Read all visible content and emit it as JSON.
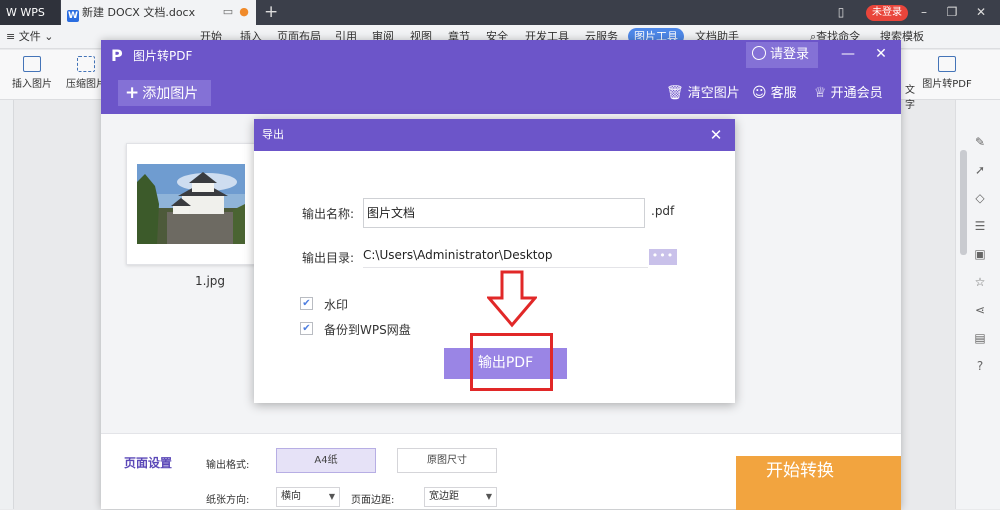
{
  "titlebar": {
    "app_tab": "WPS",
    "doc_tab": "新建 DOCX 文档.docx",
    "login_badge": "未登录"
  },
  "menubar": {
    "file": "文件",
    "items": [
      "开始",
      "插入",
      "页面布局",
      "引用",
      "审阅",
      "视图",
      "章节",
      "安全",
      "开发工具",
      "云服务",
      "图片工具",
      "文档助手"
    ],
    "right": [
      "查找命令",
      "搜索模板"
    ]
  },
  "ribbon": {
    "left_buttons": [
      "插入图片",
      "压缩图片"
    ],
    "right_buttons": [
      "文字",
      "图片转PDF"
    ]
  },
  "pdf_app": {
    "title": "图片转PDF",
    "login": "请登录",
    "add_image": "添加图片",
    "clear_images": "清空图片",
    "customer_service": "客服",
    "vip": "开通会员",
    "image_name": "1.jpg"
  },
  "settings": {
    "title": "页面设置",
    "output_format_label": "输出格式:",
    "format_a4": "A4纸",
    "format_original": "原图尺寸",
    "orientation_label": "纸张方向:",
    "orientation_value": "横向",
    "margin_label": "页面边距:",
    "margin_value": "宽边距",
    "start": "开始转换"
  },
  "export_dialog": {
    "title": "导出",
    "name_label": "输出名称:",
    "name_value": "图片文档",
    "ext": ".pdf",
    "dir_label": "输出目录:",
    "dir_value": "C:\\Users\\Administrator\\Desktop",
    "browse": "•••",
    "watermark": "水印",
    "watermark_checked": true,
    "backup": "备份到WPS网盘",
    "backup_checked": true,
    "output_button": "输出PDF"
  },
  "colors": {
    "purple": "#6c55c9",
    "output_button": "#9a85e5",
    "highlight": "#e12828",
    "start_button": "#f2a43f"
  }
}
